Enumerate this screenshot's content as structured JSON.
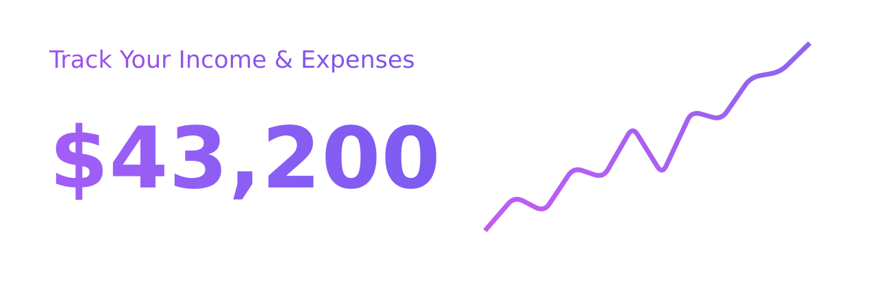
{
  "header": {
    "title": "Track Your Income & Expenses"
  },
  "balance": {
    "amount": "$43,200"
  },
  "trend": {
    "icon": "trend-line-icon",
    "colors": {
      "start": "#c35cf3",
      "end": "#8a66ed"
    },
    "points": [
      {
        "x": 0,
        "y": 0
      },
      {
        "x": 1,
        "y": 2.0
      },
      {
        "x": 2,
        "y": 1.1
      },
      {
        "x": 3,
        "y": 3.7
      },
      {
        "x": 4,
        "y": 3.1
      },
      {
        "x": 5,
        "y": 6.1
      },
      {
        "x": 6,
        "y": 3.3
      },
      {
        "x": 7,
        "y": 7.0
      },
      {
        "x": 8,
        "y": 6.5
      },
      {
        "x": 9,
        "y": 9.0
      },
      {
        "x": 10,
        "y": 9.3
      },
      {
        "x": 11,
        "y": 11.0
      }
    ]
  }
}
